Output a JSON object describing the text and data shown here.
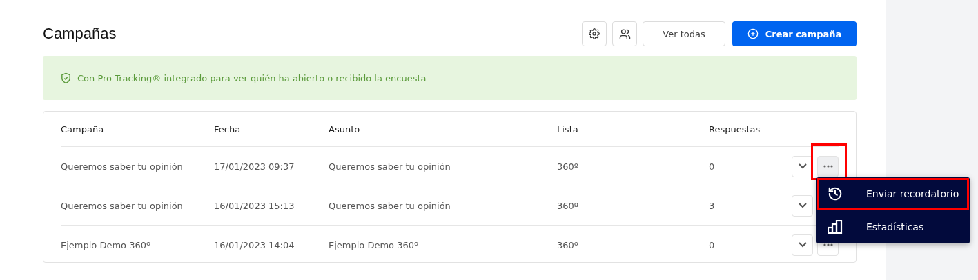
{
  "title": "Campañas",
  "toolbar": {
    "view_all": "Ver todas",
    "create": "Crear campaña"
  },
  "banner": {
    "text": "Con Pro Tracking® integrado para ver quién ha abierto o recibido la encuesta"
  },
  "table": {
    "columns": [
      "Campaña",
      "Fecha",
      "Asunto",
      "Lista",
      "Respuestas"
    ],
    "rows": [
      {
        "cells": [
          "Queremos saber tu opinión",
          "17/01/2023 09:37",
          "Queremos saber tu opinión",
          "360º",
          "0"
        ],
        "menu_open": true,
        "highlighted": true
      },
      {
        "cells": [
          "Queremos saber tu opinión",
          "16/01/2023 15:13",
          "Queremos saber tu opinión",
          "360º",
          "3"
        ],
        "menu_open": false,
        "highlighted": false
      },
      {
        "cells": [
          "Ejemplo Demo 360º",
          "16/01/2023 14:04",
          "Ejemplo Demo 360º",
          "360º",
          "0"
        ],
        "menu_open": false,
        "highlighted": false
      }
    ]
  },
  "menu": {
    "items": [
      {
        "kind": "reminder",
        "label": "Enviar recordatorio",
        "highlighted": true
      },
      {
        "kind": "stats",
        "label": "Estadísticas",
        "highlighted": false
      }
    ]
  }
}
